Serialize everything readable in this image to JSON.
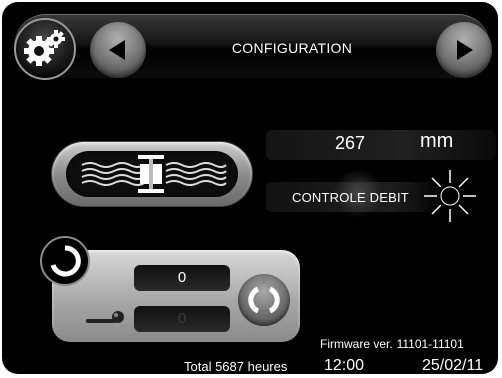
{
  "header": {
    "title": "CONFIGURATION",
    "settings_icon": "gears-icon",
    "prev_icon": "triangle-left-icon",
    "next_icon": "triangle-right-icon"
  },
  "sensor": {
    "icon": "sensor-waves-icon"
  },
  "measure": {
    "value": "267",
    "unit": "mm"
  },
  "control": {
    "label": "CONTROLE DEBIT",
    "icon": "sun-icon"
  },
  "panel": {
    "spinner_icon": "spinner-icon",
    "slider_icon": "slider-icon",
    "refresh_icon": "refresh-icon",
    "field1_value": "0",
    "field2_value": "0"
  },
  "footer": {
    "firmware_label": "Firmware ver.",
    "firmware_version": "11101-11101",
    "total_hours": "Total 5687 heures",
    "time": "12:00",
    "date": "25/02/11"
  }
}
